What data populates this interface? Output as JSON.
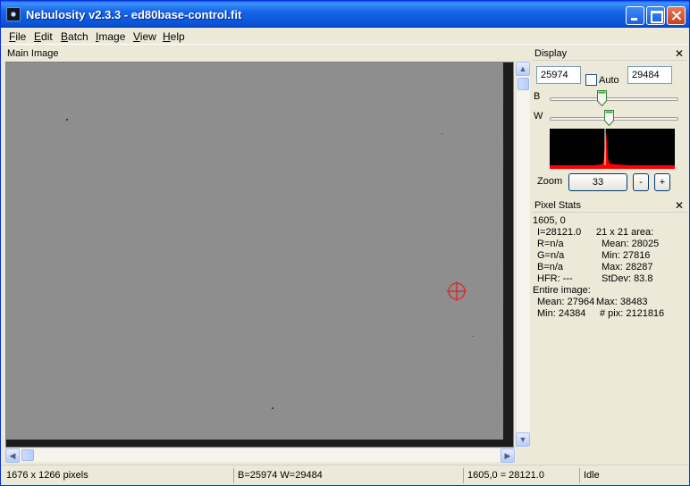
{
  "window": {
    "title": "Nebulosity v2.3.3 - ed80base-control.fit"
  },
  "menu": {
    "items": [
      "File",
      "Edit",
      "Batch",
      "Image",
      "View",
      "Help"
    ]
  },
  "main_image": {
    "header": "Main Image"
  },
  "display": {
    "header": "Display",
    "black_value": "25974",
    "white_value": "29484",
    "auto_label": "Auto",
    "auto_checked": false,
    "b_label": "B",
    "w_label": "W",
    "zoom_label": "Zoom",
    "zoom_value": "33",
    "zoom_minus": "-",
    "zoom_plus": "+"
  },
  "pixel_stats": {
    "header": "Pixel Stats",
    "coords": "1605, 0",
    "intensity": "I=28121.0",
    "r": "R=n/a",
    "g": "G=n/a",
    "b": "B=n/a",
    "hfr": "HFR: ---",
    "area_title": "21 x 21 area:",
    "area_mean": "Mean: 28025",
    "area_min": "Min: 27816",
    "area_max": "Max: 28287",
    "area_stdev": "StDev: 83.8",
    "entire_title": "Entire image:",
    "entire_mean": "Mean: 27964",
    "entire_max": "Max: 38483",
    "entire_min": "Min: 24384",
    "entire_npix": "# pix: 2121816"
  },
  "status": {
    "size": "1676 x 1266 pixels",
    "bw": "B=25974 W=29484",
    "pixel": "1605,0 = 28121.0",
    "state": "Idle"
  },
  "colors": {
    "titlebar": "#0953d6",
    "histogram_peak": "#ff0000",
    "crosshair": "#e02020"
  }
}
